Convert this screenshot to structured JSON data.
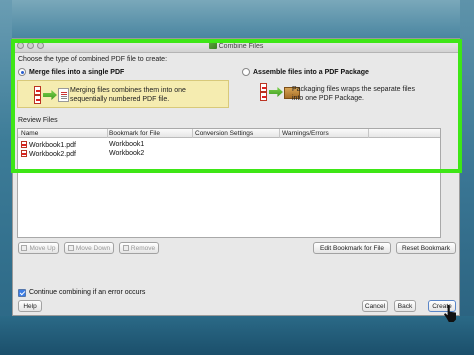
{
  "window": {
    "title": "Combine Files"
  },
  "prompt": "Choose the type of combined PDF file to create:",
  "options": [
    {
      "label": "Merge files into a single PDF",
      "selected": true,
      "description": [
        "Merging files combines them into one",
        "sequentially numbered PDF file."
      ]
    },
    {
      "label": "Assemble files into a PDF Package",
      "selected": false,
      "description": [
        "Packaging files wraps the separate files",
        "into one PDF Package."
      ]
    }
  ],
  "review": {
    "title": "Review Files",
    "columns": [
      "Name",
      "Bookmark for File",
      "Conversion Settings",
      "Warnings/Errors"
    ],
    "rows": [
      {
        "name": "Workbook1.pdf",
        "bookmark": "Workbook1"
      },
      {
        "name": "Workbook2.pdf",
        "bookmark": "Workbook2"
      }
    ]
  },
  "buttons": {
    "move_up": "Move Up",
    "move_down": "Move Down",
    "remove": "Remove",
    "edit_bookmark": "Edit Bookmark for File",
    "reset_bookmark": "Reset Bookmark",
    "help": "Help",
    "cancel": "Cancel",
    "back": "Back",
    "create": "Create"
  },
  "continue_checkbox": {
    "label": "Continue combining if an error occurs",
    "checked": true
  },
  "colors": {
    "highlight": "#3ee616",
    "merge_bg": "#f5ecb0"
  }
}
